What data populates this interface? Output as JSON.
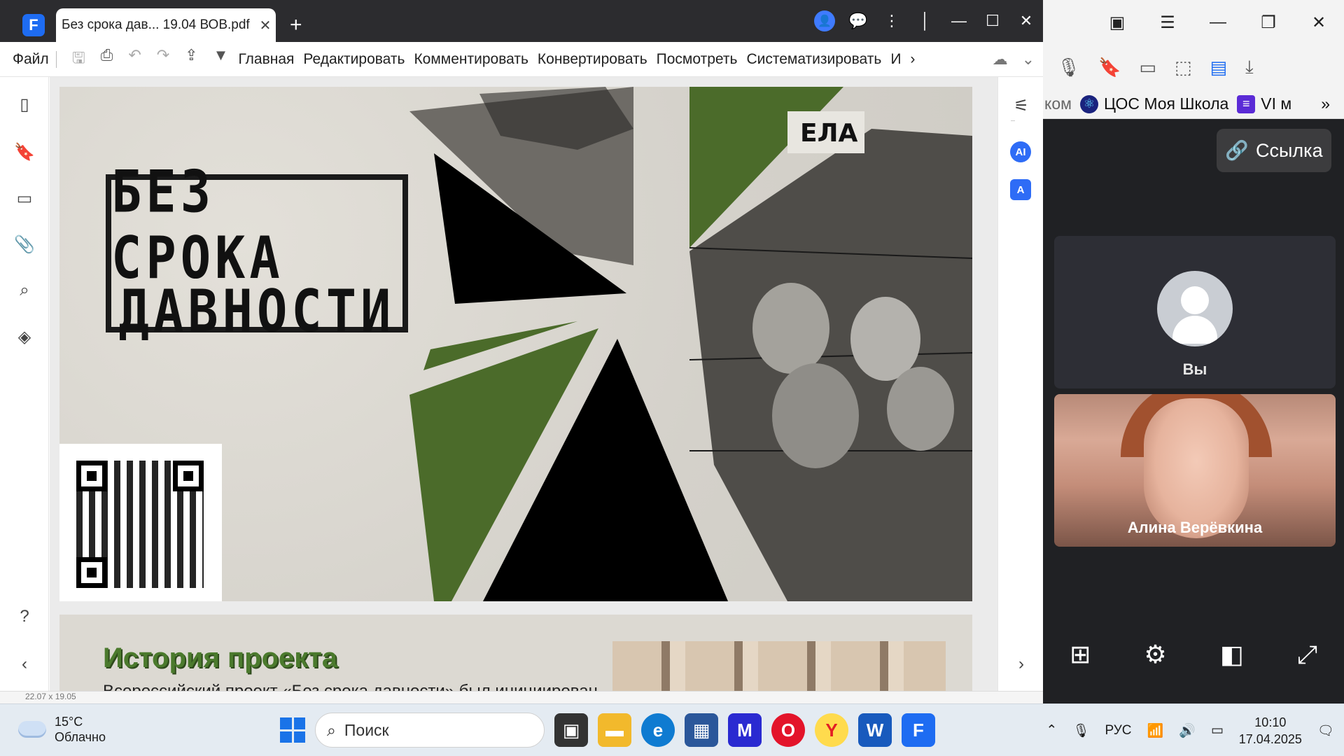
{
  "app": {
    "tab_title": "Без срока дав... 19.04 ВОВ.pdf",
    "menu_file": "Файл",
    "menus": [
      "Главная",
      "Редактировать",
      "Комментировать",
      "Конвертировать",
      "Посмотреть",
      "Систематизировать",
      "И"
    ],
    "status_left": "22.07 x 19.05"
  },
  "document": {
    "page1": {
      "title_line1": "БЕЗ СРОКА",
      "title_line2": "ДАВНОСТИ",
      "sign_text": "ЕЛА"
    },
    "page2": {
      "heading": "История проекта",
      "text": "Всероссийский проект «Без срока давности» был инициирован"
    }
  },
  "browser": {
    "bookmarks": [
      {
        "label": "ком"
      },
      {
        "label": "ЦОС Моя Школа"
      },
      {
        "label": "VI м"
      }
    ],
    "link_button": "Ссылка",
    "tiles": [
      {
        "name": "Вы"
      },
      {
        "name": "Алина Верёвкина"
      }
    ]
  },
  "taskbar": {
    "weather_temp": "15°C",
    "weather_desc": "Облачно",
    "search_placeholder": "Поиск",
    "language": "РУС",
    "time": "10:10",
    "date": "17.04.2025"
  },
  "colors": {
    "accent_blue": "#1e6cf2",
    "olive_green": "#4b6b2a",
    "titlebar": "#2c2c2f",
    "meet_bg": "#202124"
  }
}
